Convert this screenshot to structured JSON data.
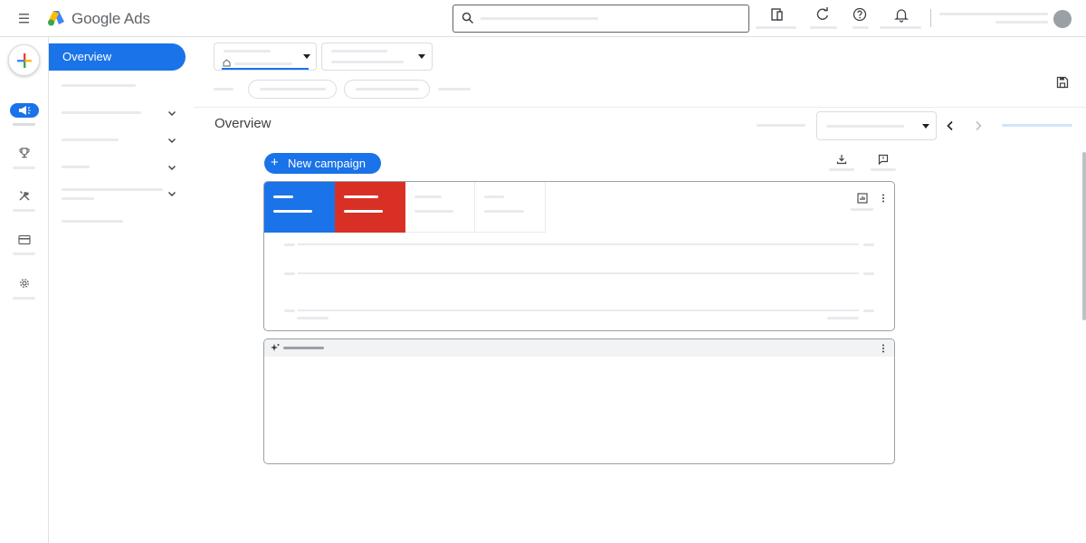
{
  "app": {
    "brand": "Google Ads"
  },
  "search": {
    "placeholder": "",
    "value": ""
  },
  "nav": {
    "overview_label": "Overview"
  },
  "page": {
    "title": "Overview"
  },
  "actions": {
    "new_campaign_label": "New campaign",
    "new_campaign_plus": "+"
  },
  "icons": {
    "menu": "menu-icon",
    "search": "search-icon",
    "reports": "reports-icon",
    "refresh": "refresh-icon",
    "help": "help-icon",
    "notifications": "bell-icon",
    "create": "plus-icon",
    "campaigns": "megaphone-icon",
    "goals": "trophy-icon",
    "tools": "tools-icon",
    "billing": "billing-icon",
    "admin": "gear-icon",
    "save": "save-icon",
    "download": "download-icon",
    "feedback": "feedback-icon",
    "chart": "chart-icon",
    "more": "more-vert-icon",
    "insights": "sparkle-icon"
  },
  "colors": {
    "accent": "#1a73e8",
    "metric_1": "#1a73e8",
    "metric_2": "#d93025",
    "logo_blue": "#4285f4",
    "logo_yellow": "#fbbc04",
    "logo_green": "#34a853"
  }
}
